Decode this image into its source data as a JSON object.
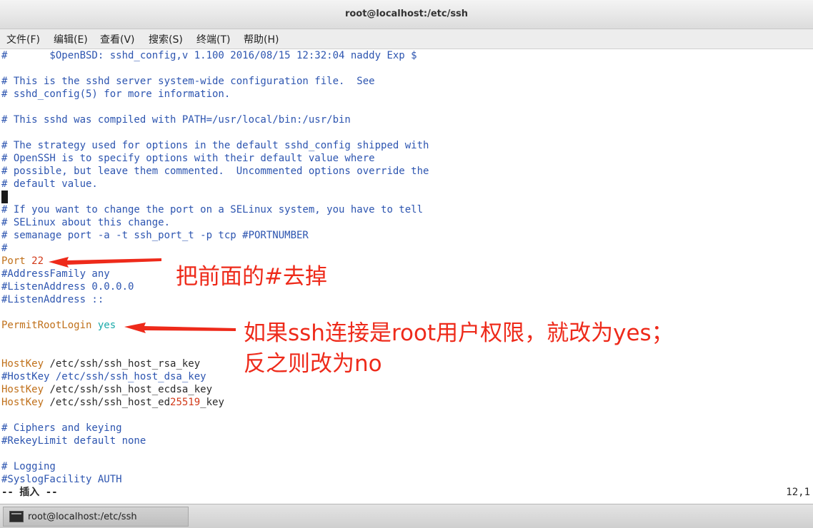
{
  "window": {
    "title": "root@localhost:/etc/ssh"
  },
  "menu": [
    "文件(F)",
    "编辑(E)",
    "查看(V)",
    "搜索(S)",
    "终端(T)",
    "帮助(H)"
  ],
  "editor": {
    "lines": [
      "#       $OpenBSD: sshd_config,v 1.100 2016/08/15 12:32:04 naddy Exp $",
      "",
      "# This is the sshd server system-wide configuration file.  See",
      "# sshd_config(5) for more information.",
      "",
      "# This sshd was compiled with PATH=/usr/local/bin:/usr/bin",
      "",
      "# The strategy used for options in the default sshd_config shipped with",
      "# OpenSSH is to specify options with their default value where",
      "# possible, but leave them commented.  Uncommented options override the",
      "# default value.",
      "",
      "# If you want to change the port on a SELinux system, you have to tell",
      "# SELinux about this change.",
      "# semanage port -a -t ssh_port_t -p tcp #PORTNUMBER",
      "#",
      "Port 22",
      "#AddressFamily any",
      "#ListenAddress 0.0.0.0",
      "#ListenAddress ::",
      "",
      "PermitRootLogin yes",
      "",
      "",
      "HostKey /etc/ssh/ssh_host_rsa_key",
      "#HostKey /etc/ssh/ssh_host_dsa_key",
      "HostKey /etc/ssh/ssh_host_ecdsa_key",
      "HostKey /etc/ssh/ssh_host_ed25519_key",
      "",
      "# Ciphers and keying",
      "#RekeyLimit default none",
      "",
      "# Logging",
      "#SyslogFacility AUTH"
    ],
    "status_mode": "-- 插入 --",
    "cursor_pos": "12,1"
  },
  "annotations": {
    "port": "把前面的#去掉",
    "permit_line1": "如果ssh连接是root用户权限，就改为yes；",
    "permit_line2": "反之则改为no",
    "arrow_color": "#ee2a1a"
  },
  "taskbar": {
    "item": "root@localhost:/etc/ssh"
  }
}
